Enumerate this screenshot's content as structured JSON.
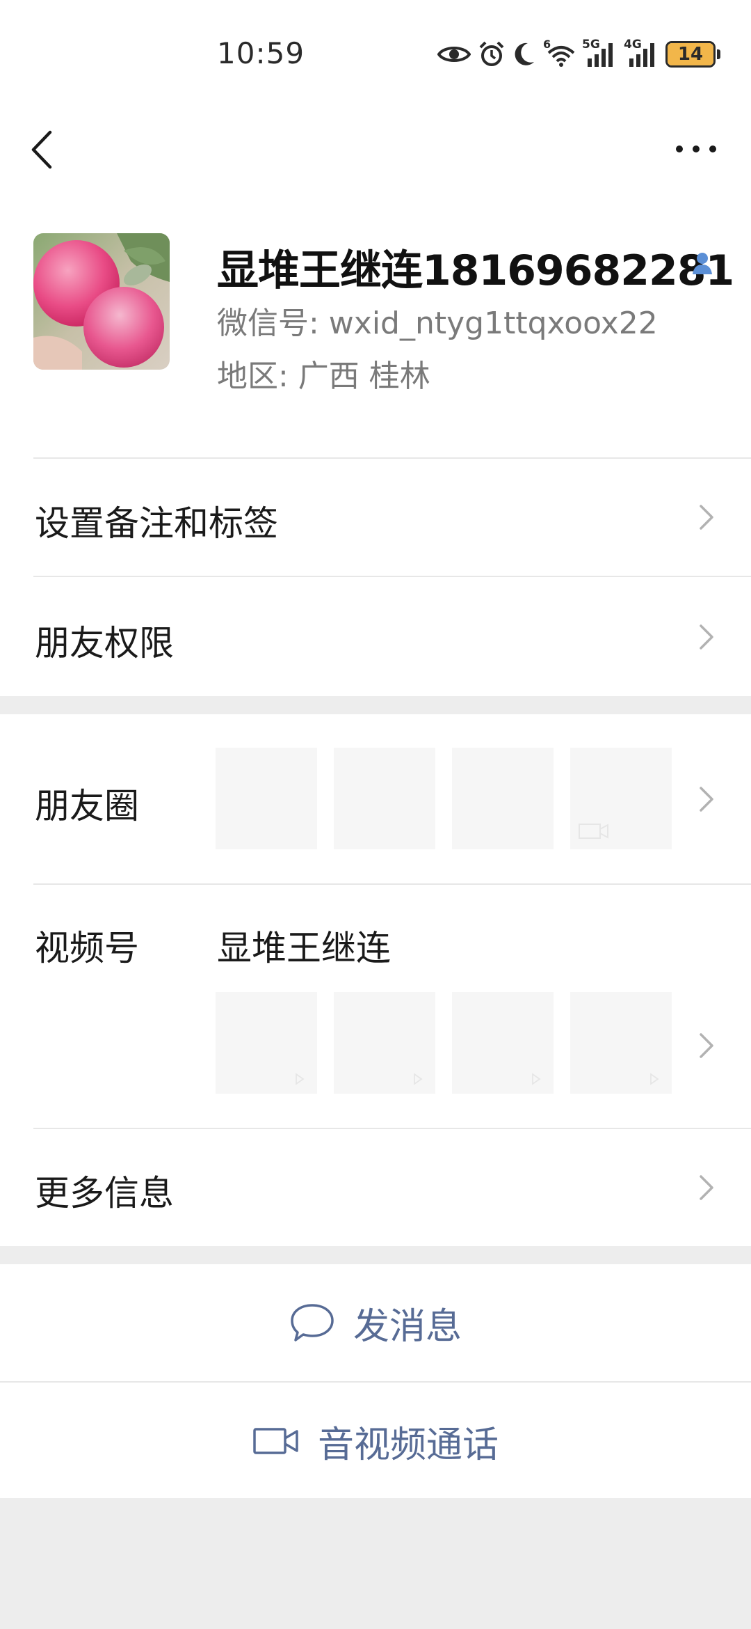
{
  "status_bar": {
    "time": "10:59",
    "network_labels": [
      "6",
      "5G",
      "4G"
    ],
    "battery_level": "14",
    "icons": [
      "eye-icon",
      "alarm-icon",
      "moon-icon",
      "wifi-icon",
      "signal-icon",
      "signal-icon",
      "battery-icon"
    ]
  },
  "header": {
    "back_icon": "chevron-left-icon",
    "more_icon": "more-dots-icon"
  },
  "profile": {
    "name": "显堆王继连18169682281",
    "wechat_id": "微信号:  wxid_ntyg1ttqxoox22",
    "region": "地区:  广西  桂林",
    "verify_icon": "contact-person-icon"
  },
  "list": {
    "remark_tags": "设置备注和标签",
    "friend_permissions": "朋友权限",
    "moments": "朋友圈",
    "channels": "视频号",
    "channel_name": "显堆王继连",
    "more_info": "更多信息"
  },
  "actions": {
    "send_message": "发消息",
    "av_call": "音视频通话"
  },
  "colors": {
    "link_blue": "#576b95",
    "background": "#ededed",
    "battery_fill": "#f2b64a",
    "verify_blue": "#5b8fd6"
  }
}
